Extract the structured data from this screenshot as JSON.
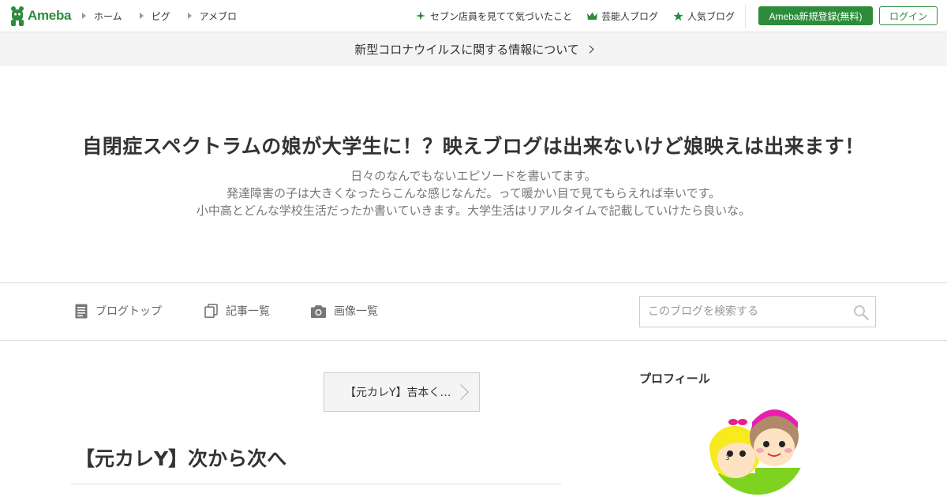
{
  "header": {
    "logo_text": "Ameba",
    "nav_left": [
      "ホーム",
      "ピグ",
      "アメブロ"
    ],
    "nav_right": [
      "セブン店員を見てて気づいたこと",
      "芸能人ブログ",
      "人気ブログ"
    ],
    "register_label": "Ameba新規登録(無料)",
    "login_label": "ログイン",
    "brand_color": "#2d8c3c"
  },
  "notice": {
    "text": "新型コロナウイルスに関する情報について"
  },
  "blog": {
    "title": "自閉症スペクトラムの娘が大学生に！？映えブログは出来ないけど娘映えは出来ます！",
    "description": [
      "日々のなんでもないエピソードを書いてます。",
      "発達障害の子は大きくなったらこんな感じなんだ。って暖かい目で見てもらえれば幸いです。",
      "小中高とどんな学校生活だったか書いていきます。大学生活はリアルタイムで記載していけたら良いな。"
    ]
  },
  "blog_nav": {
    "top": "ブログトップ",
    "articles": "記事一覧",
    "images": "画像一覧",
    "search_placeholder": "このブログを検索する"
  },
  "main": {
    "prev_article": "【元カレY】吉本く…",
    "article_title": "【元カレY】次から次へ"
  },
  "sidebar": {
    "profile_heading": "プロフィール"
  }
}
